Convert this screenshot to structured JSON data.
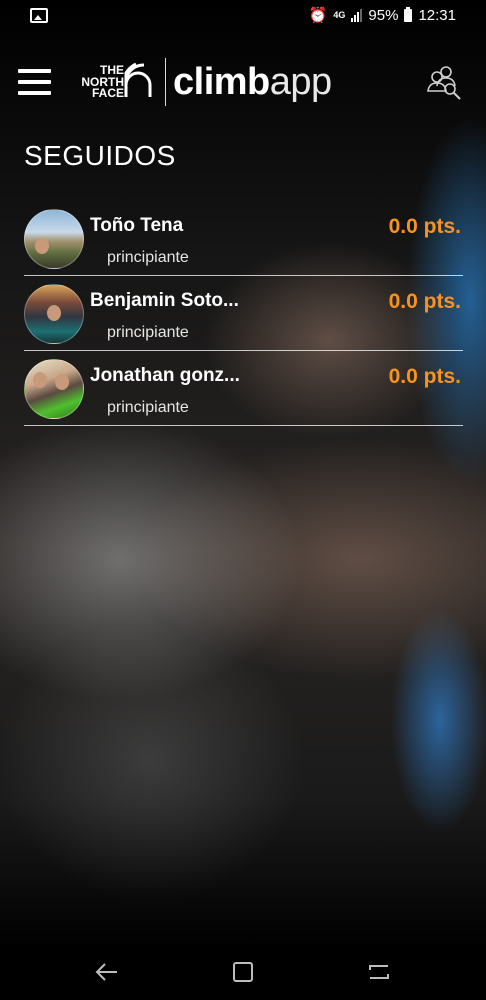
{
  "status_bar": {
    "network": "4G",
    "battery": "95%",
    "time": "12:31",
    "icons": [
      "image-icon",
      "alarm-icon",
      "signal-icon",
      "battery-icon"
    ]
  },
  "app_bar": {
    "brand_lines": [
      "THE",
      "NORTH",
      "FACE"
    ],
    "app_name_bold": "climb",
    "app_name_light": "app",
    "icons": [
      "menu-icon",
      "users-search-icon"
    ]
  },
  "page": {
    "title": "SEGUIDOS"
  },
  "follows": [
    {
      "name": "Toño Tena",
      "level": "principiante",
      "points": "0.0 pts."
    },
    {
      "name": "Benjamin Soto...",
      "level": "principiante",
      "points": "0.0 pts."
    },
    {
      "name": "Jonathan gonz...",
      "level": "principiante",
      "points": "0.0 pts."
    }
  ],
  "colors": {
    "accent": "#f7931e",
    "text": "#ffffff",
    "divider": "#d9d9d9"
  },
  "nav_bar": {
    "icons": [
      "back-icon",
      "home-icon",
      "recents-icon"
    ]
  }
}
